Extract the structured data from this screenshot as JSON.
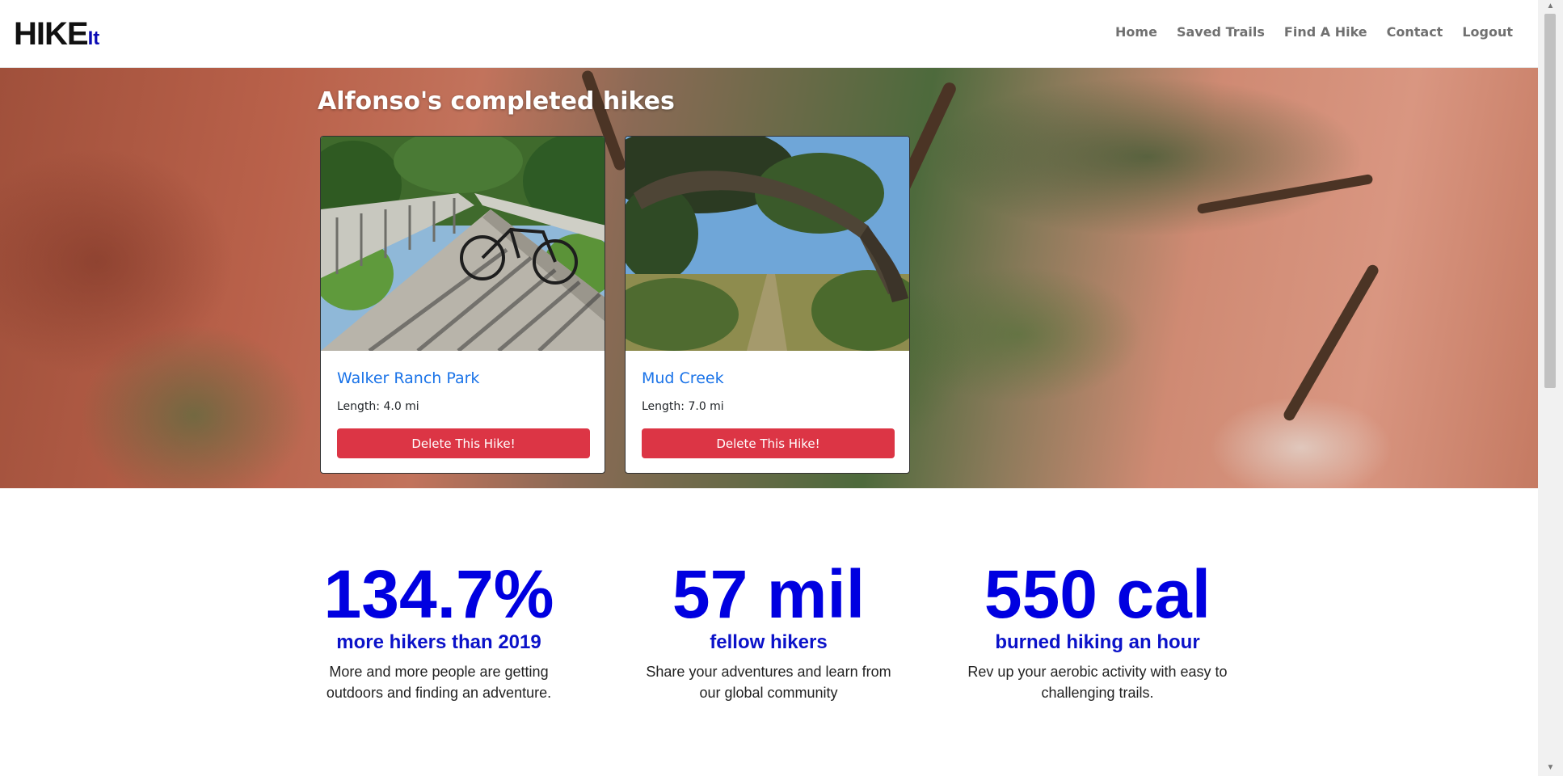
{
  "brand": {
    "main": "HIKE",
    "sub": "It"
  },
  "nav": {
    "items": [
      {
        "label": "Home"
      },
      {
        "label": "Saved Trails"
      },
      {
        "label": "Find A Hike"
      },
      {
        "label": "Contact"
      },
      {
        "label": "Logout"
      }
    ]
  },
  "hero": {
    "title": "Alfonso's completed hikes"
  },
  "hikes": [
    {
      "name": "Walker Ranch Park",
      "length": "Length: 4.0 mi",
      "button": "Delete This Hike!"
    },
    {
      "name": "Mud Creek",
      "length": "Length: 7.0 mi",
      "button": "Delete This Hike!"
    }
  ],
  "stats": [
    {
      "value": "134.7%",
      "label": "more hikers than 2019",
      "description": "More and more people are getting outdoors and finding an adventure."
    },
    {
      "value": "57 mil",
      "label": "fellow hikers",
      "description": "Share your adventures and learn from our global community"
    },
    {
      "value": "550 cal",
      "label": "burned hiking an hour",
      "description": "Rev up your aerobic activity with easy to challenging trails."
    }
  ],
  "colors": {
    "accent": "#0000e0",
    "link": "#1a73e8",
    "danger": "#dc3545",
    "brand_sub": "#0b0bb5"
  }
}
